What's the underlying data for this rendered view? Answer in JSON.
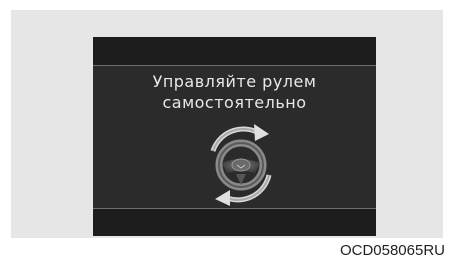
{
  "display": {
    "message_line1": "Управляйте рулем",
    "message_line2": "самостоятельно"
  },
  "icons": {
    "wheel": "steering-wheel-icon",
    "arrow_top": "curved-arrow-clockwise-icon",
    "arrow_bottom": "curved-arrow-counterclockwise-icon"
  },
  "figure_code": "OCD058065RU",
  "colors": {
    "panel_background": "#e6e6e6",
    "screen_background": "#2b2b2b",
    "bar_background": "#1d1d1d",
    "text": "#e8e8e8"
  }
}
